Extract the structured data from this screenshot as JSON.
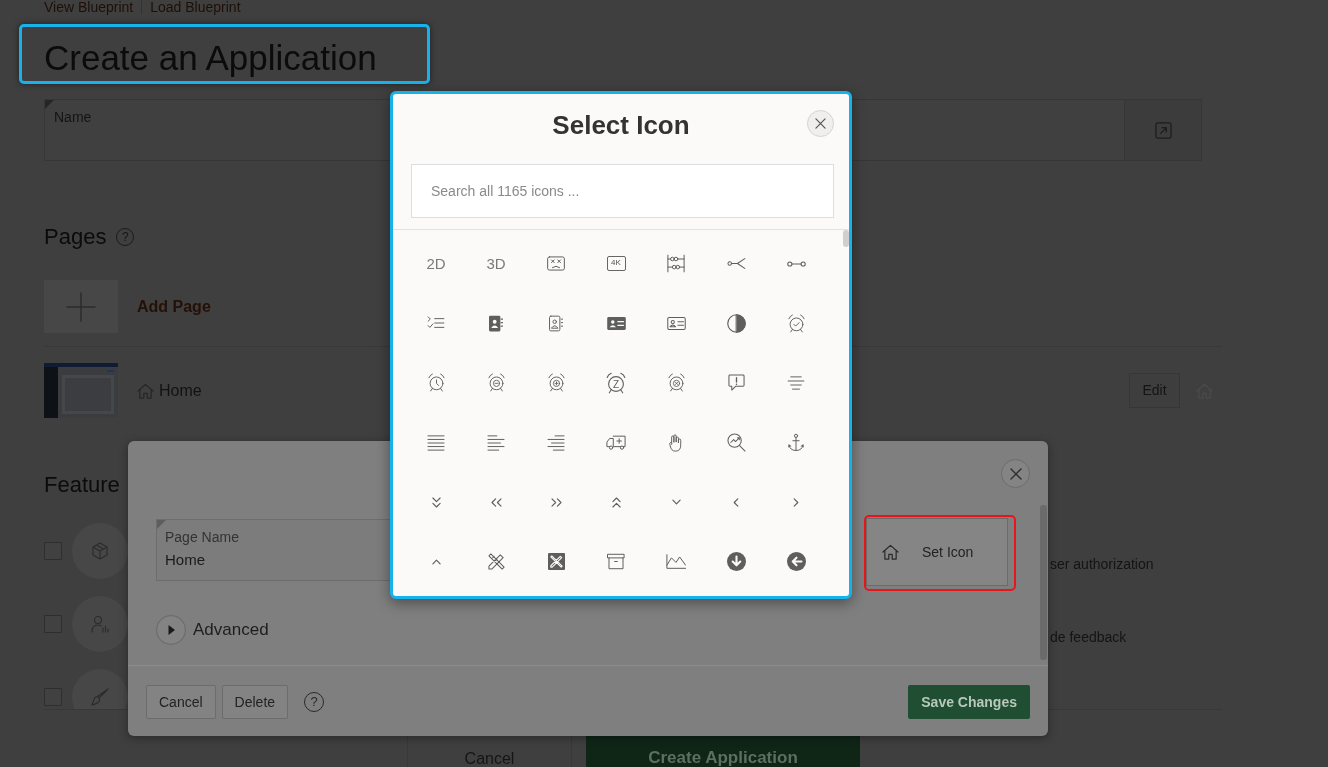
{
  "header_links": [
    {
      "label": "View Blueprint"
    },
    {
      "label": "Load Blueprint"
    }
  ],
  "title": {
    "text": "Create an Application",
    "highlighted": true
  },
  "name_field": {
    "label": "Name"
  },
  "pages": {
    "heading": "Pages",
    "help": "?",
    "add_label": "Add Page",
    "items": [
      {
        "name": "Home",
        "action": "Edit"
      }
    ]
  },
  "features": {
    "heading": "Feature",
    "items": [
      {
        "checked": false,
        "description": "ser authorization"
      },
      {
        "checked": false,
        "description": "de feedback"
      },
      {
        "checked": false
      }
    ]
  },
  "actions": [
    {
      "label": "Cancel",
      "kind": "secondary"
    },
    {
      "label": "Create Application",
      "kind": "primary"
    }
  ],
  "edit_page_dialog": {
    "page_name": {
      "label": "Page Name",
      "value": "Home"
    },
    "set_icon": {
      "label": "Set Icon",
      "highlighted": true
    },
    "advanced": {
      "label": "Advanced",
      "expanded": false
    },
    "help": "?",
    "buttons": [
      {
        "label": "Cancel",
        "kind": "secondary"
      },
      {
        "label": "Delete",
        "kind": "secondary"
      },
      {
        "label": "Save Changes",
        "kind": "primary"
      }
    ]
  },
  "select_icon_dialog": {
    "title": "Select Icon",
    "highlighted": true,
    "search": {
      "placeholder": "Search all 1165 icons ..."
    },
    "icons": [
      {
        "kind": "text",
        "text": "2D"
      },
      {
        "kind": "text",
        "text": "3D"
      },
      {
        "kind": "glyph"
      },
      {
        "kind": "boxed_text",
        "text": "4K"
      },
      {
        "kind": "glyph"
      },
      {
        "kind": "glyph"
      },
      {
        "kind": "glyph"
      },
      {
        "kind": "glyph"
      },
      {
        "kind": "glyph"
      },
      {
        "kind": "glyph"
      },
      {
        "kind": "glyph"
      },
      {
        "kind": "glyph"
      },
      {
        "kind": "glyph"
      },
      {
        "kind": "glyph"
      },
      {
        "kind": "glyph"
      },
      {
        "kind": "glyph"
      },
      {
        "kind": "glyph"
      },
      {
        "kind": "alarm_text",
        "text": "Z"
      },
      {
        "kind": "glyph"
      },
      {
        "kind": "glyph"
      },
      {
        "kind": "glyph"
      },
      {
        "kind": "glyph"
      },
      {
        "kind": "glyph"
      },
      {
        "kind": "glyph"
      },
      {
        "kind": "glyph"
      },
      {
        "kind": "glyph"
      },
      {
        "kind": "glyph"
      },
      {
        "kind": "glyph"
      },
      {
        "kind": "glyph"
      },
      {
        "kind": "glyph"
      },
      {
        "kind": "glyph"
      },
      {
        "kind": "glyph"
      },
      {
        "kind": "glyph"
      },
      {
        "kind": "glyph"
      },
      {
        "kind": "glyph"
      },
      {
        "kind": "glyph"
      },
      {
        "kind": "glyph"
      },
      {
        "kind": "glyph"
      },
      {
        "kind": "glyph"
      },
      {
        "kind": "glyph"
      },
      {
        "kind": "glyph"
      },
      {
        "kind": "glyph"
      }
    ]
  }
}
